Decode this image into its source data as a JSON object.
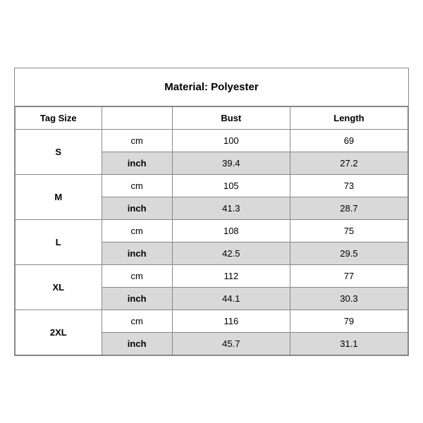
{
  "title": "Material: Polyester",
  "columns": {
    "tag_size": "Tag Size",
    "unit": "",
    "bust": "Bust",
    "length": "Length"
  },
  "rows": [
    {
      "size": "S",
      "cm": {
        "bust": "100",
        "length": "69"
      },
      "inch": {
        "bust": "39.4",
        "length": "27.2"
      }
    },
    {
      "size": "M",
      "cm": {
        "bust": "105",
        "length": "73"
      },
      "inch": {
        "bust": "41.3",
        "length": "28.7"
      }
    },
    {
      "size": "L",
      "cm": {
        "bust": "108",
        "length": "75"
      },
      "inch": {
        "bust": "42.5",
        "length": "29.5"
      }
    },
    {
      "size": "XL",
      "cm": {
        "bust": "112",
        "length": "77"
      },
      "inch": {
        "bust": "44.1",
        "length": "30.3"
      }
    },
    {
      "size": "2XL",
      "cm": {
        "bust": "116",
        "length": "79"
      },
      "inch": {
        "bust": "45.7",
        "length": "31.1"
      }
    }
  ],
  "units": {
    "cm": "cm",
    "inch": "inch"
  }
}
